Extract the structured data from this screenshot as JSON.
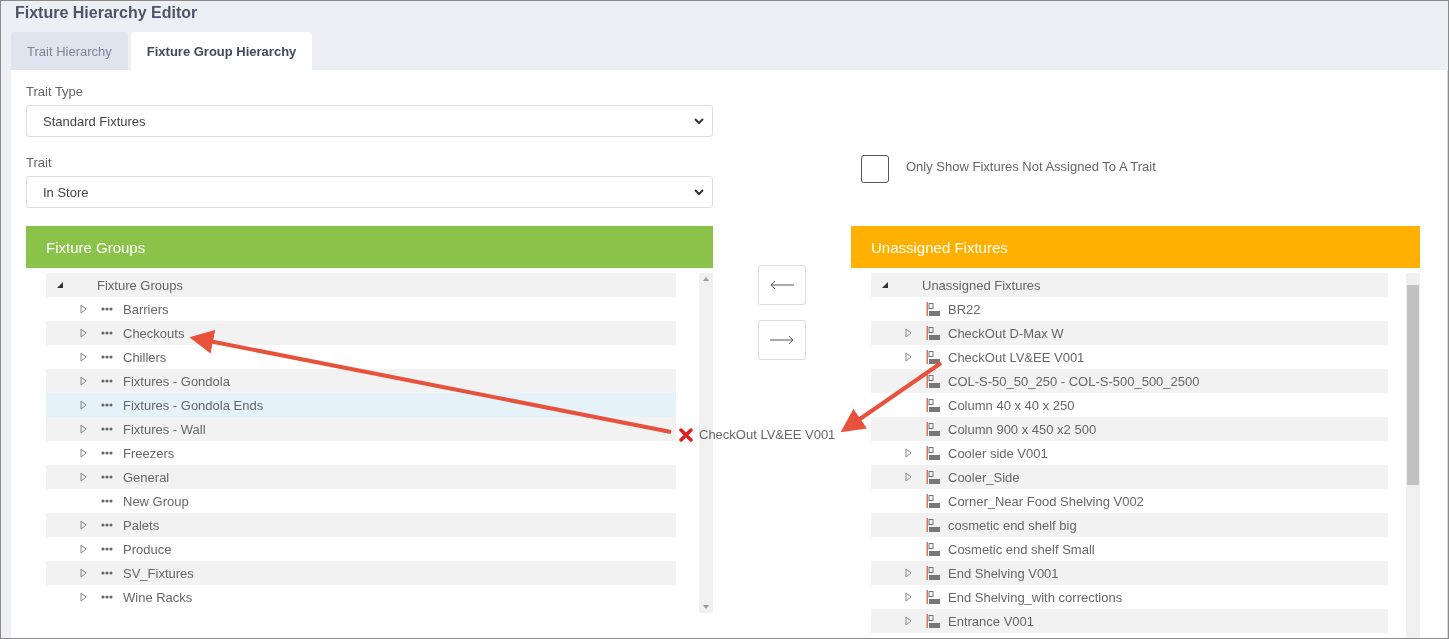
{
  "title": "Fixture Hierarchy Editor",
  "tabs": [
    {
      "label": "Trait Hierarchy",
      "selected": false
    },
    {
      "label": "Fixture Group Hierarchy",
      "selected": true
    }
  ],
  "fields": [
    {
      "label": "Trait Type",
      "value": "Standard Fixtures"
    },
    {
      "label": "Trait",
      "value": "In Store"
    }
  ],
  "filter": {
    "label": "Only Show Fixtures Not Assigned To A Trait",
    "checked": false
  },
  "panels": [
    {
      "header": "Fixture Groups",
      "color": "#8bc34a",
      "tree": {
        "label": "Fixture Groups",
        "expanded": true,
        "children": [
          {
            "label": "Barriers",
            "kind": "group",
            "expandable": true,
            "selected": false
          },
          {
            "label": "Checkouts",
            "kind": "group",
            "expandable": true,
            "selected": false
          },
          {
            "label": "Chillers",
            "kind": "group",
            "expandable": true,
            "selected": false
          },
          {
            "label": "Fixtures - Gondola",
            "kind": "group",
            "expandable": true,
            "selected": false
          },
          {
            "label": "Fixtures - Gondola Ends",
            "kind": "group",
            "expandable": true,
            "selected": true
          },
          {
            "label": "Fixtures - Wall",
            "kind": "group",
            "expandable": true,
            "selected": false
          },
          {
            "label": "Freezers",
            "kind": "group",
            "expandable": true,
            "selected": false
          },
          {
            "label": "General",
            "kind": "group",
            "expandable": true,
            "selected": false
          },
          {
            "label": "New Group",
            "kind": "group",
            "expandable": false,
            "selected": false
          },
          {
            "label": "Palets",
            "kind": "group",
            "expandable": true,
            "selected": false
          },
          {
            "label": "Produce",
            "kind": "group",
            "expandable": true,
            "selected": false
          },
          {
            "label": "SV_Fixtures",
            "kind": "group",
            "expandable": true,
            "selected": false
          },
          {
            "label": "Wine Racks",
            "kind": "group",
            "expandable": true,
            "selected": false
          }
        ]
      }
    },
    {
      "header": "Unassigned Fixtures",
      "color": "#ffb000",
      "tree": {
        "label": "Unassigned Fixtures",
        "expanded": true,
        "children": [
          {
            "label": "BR22",
            "kind": "fixture",
            "expandable": false,
            "selected": false
          },
          {
            "label": "CheckOut D-Max W",
            "kind": "fixture",
            "expandable": true,
            "selected": false
          },
          {
            "label": "CheckOut LV&EE V001",
            "kind": "fixture",
            "expandable": true,
            "selected": false
          },
          {
            "label": "COL-S-50_50_250 - COL-S-500_500_2500",
            "kind": "fixture",
            "expandable": false,
            "selected": false
          },
          {
            "label": "Column 40 x 40 x 250",
            "kind": "fixture",
            "expandable": false,
            "selected": false
          },
          {
            "label": "Column 900 x 450 x2 500",
            "kind": "fixture",
            "expandable": false,
            "selected": false
          },
          {
            "label": "Cooler side V001",
            "kind": "fixture",
            "expandable": true,
            "selected": false
          },
          {
            "label": "Cooler_Side",
            "kind": "fixture",
            "expandable": true,
            "selected": false
          },
          {
            "label": "Corner_Near Food Shelving V002",
            "kind": "fixture",
            "expandable": false,
            "selected": false
          },
          {
            "label": "cosmetic end shelf big",
            "kind": "fixture",
            "expandable": false,
            "selected": false
          },
          {
            "label": "Cosmetic end shelf Small",
            "kind": "fixture",
            "expandable": false,
            "selected": false
          },
          {
            "label": "End Shelving V001",
            "kind": "fixture",
            "expandable": true,
            "selected": false
          },
          {
            "label": "End Shelving_with corrections",
            "kind": "fixture",
            "expandable": true,
            "selected": false
          },
          {
            "label": "Entrance V001",
            "kind": "fixture",
            "expandable": true,
            "selected": false
          }
        ]
      }
    }
  ],
  "drag": {
    "label": "CheckOut LV&EE V001",
    "allowed": false
  }
}
